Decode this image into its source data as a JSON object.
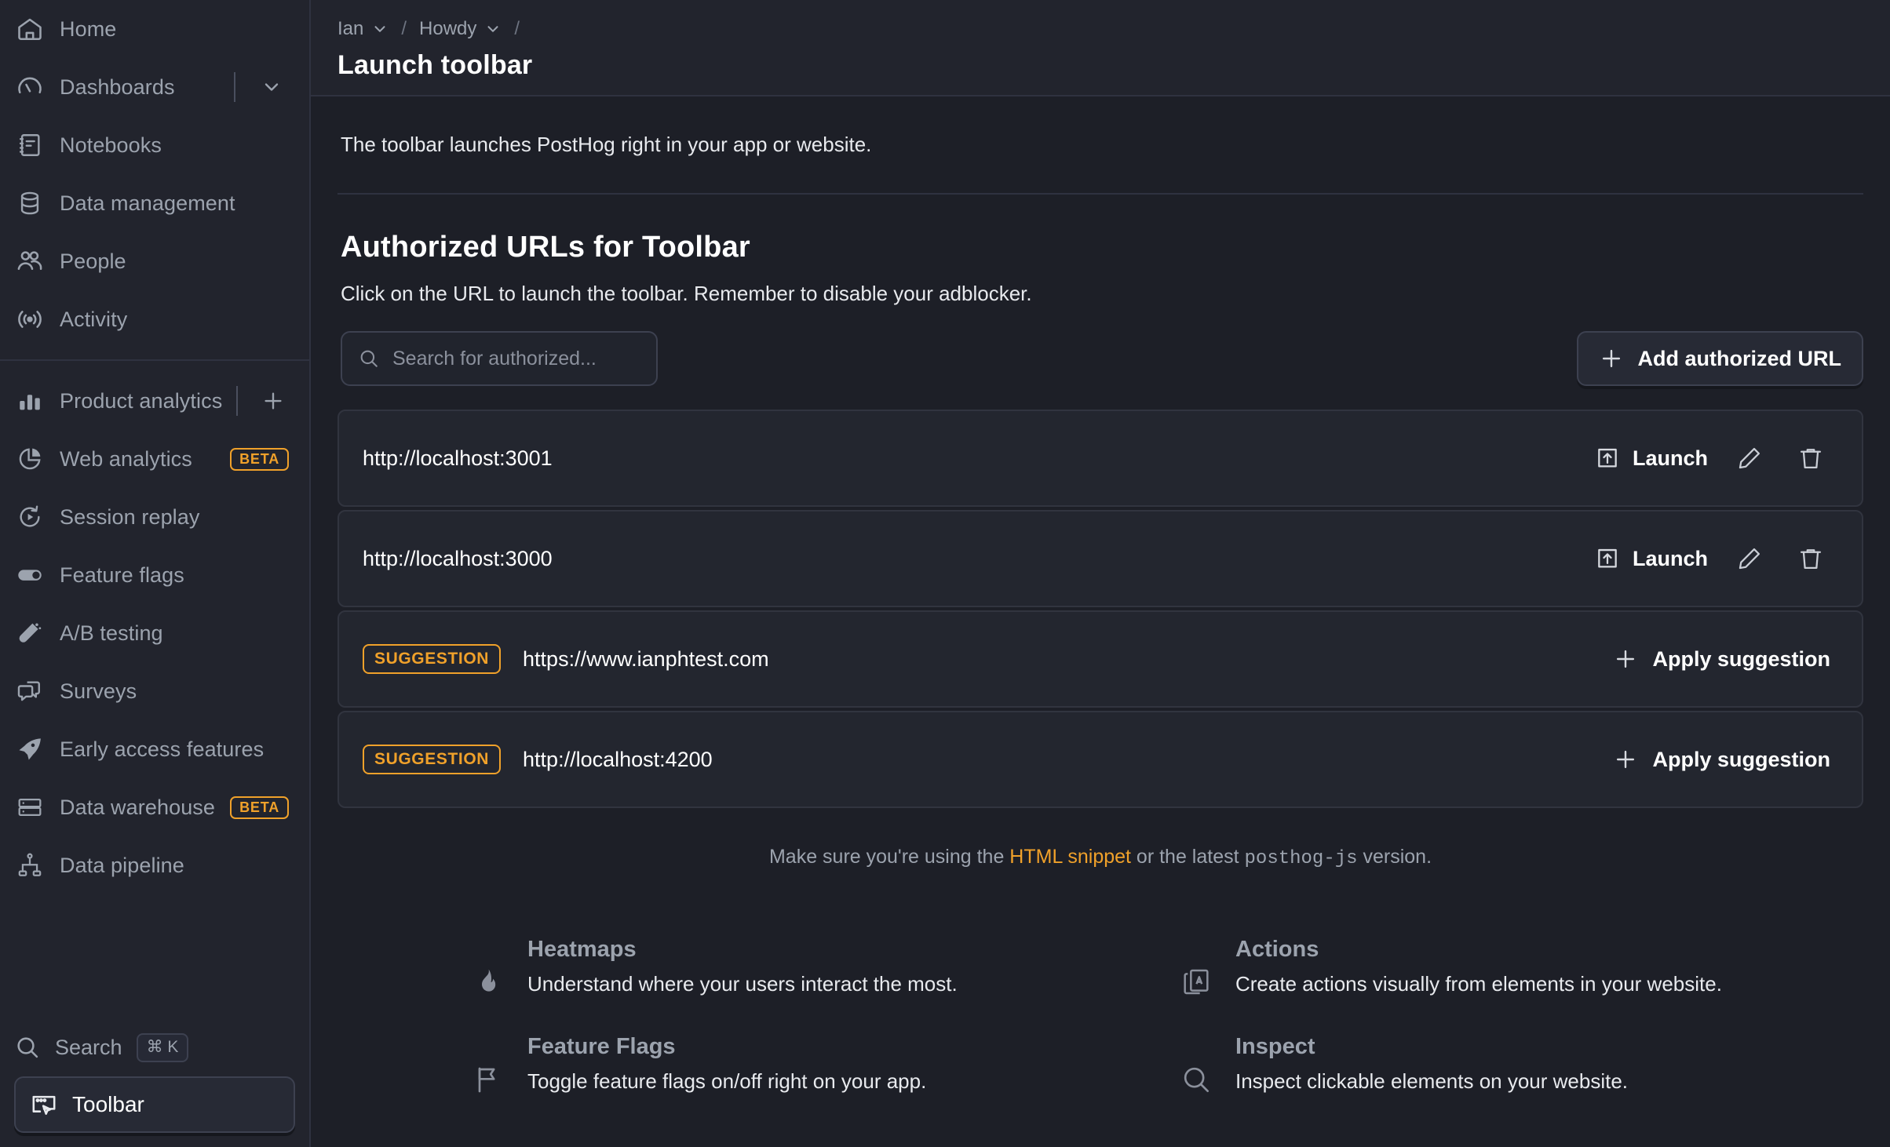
{
  "sidebar": {
    "primary_items": [
      {
        "label": "Home",
        "icon": "home-icon",
        "badge": null,
        "trailing": null
      },
      {
        "label": "Dashboards",
        "icon": "gauge-icon",
        "badge": null,
        "trailing": "chevron-down-icon"
      },
      {
        "label": "Notebooks",
        "icon": "notebook-icon",
        "badge": null,
        "trailing": null
      },
      {
        "label": "Data management",
        "icon": "database-icon",
        "badge": null,
        "trailing": null
      },
      {
        "label": "People",
        "icon": "people-icon",
        "badge": null,
        "trailing": null
      },
      {
        "label": "Activity",
        "icon": "broadcast-icon",
        "badge": null,
        "trailing": null
      }
    ],
    "product_items": [
      {
        "label": "Product analytics",
        "icon": "bar-chart-icon",
        "badge": null,
        "trailing": "plus-icon"
      },
      {
        "label": "Web analytics",
        "icon": "pie-chart-icon",
        "badge": "BETA",
        "trailing": null
      },
      {
        "label": "Session replay",
        "icon": "replay-icon",
        "badge": null,
        "trailing": null
      },
      {
        "label": "Feature flags",
        "icon": "toggle-icon",
        "badge": null,
        "trailing": null
      },
      {
        "label": "A/B testing",
        "icon": "flask-icon",
        "badge": null,
        "trailing": null
      },
      {
        "label": "Surveys",
        "icon": "chat-icon",
        "badge": null,
        "trailing": null
      },
      {
        "label": "Early access features",
        "icon": "rocket-icon",
        "badge": null,
        "trailing": null
      },
      {
        "label": "Data warehouse",
        "icon": "server-icon",
        "badge": "BETA",
        "trailing": null
      },
      {
        "label": "Data pipeline",
        "icon": "pipeline-icon",
        "badge": null,
        "trailing": null
      }
    ],
    "search": {
      "label": "Search",
      "shortcut": "⌘ K"
    },
    "toolbar": {
      "label": "Toolbar",
      "active": true
    }
  },
  "header": {
    "breadcrumbs": [
      {
        "label": "Ian",
        "has_chevron": true
      },
      {
        "label": "Howdy",
        "has_chevron": true
      }
    ],
    "separator": "/",
    "title": "Launch toolbar"
  },
  "main": {
    "intro": "The toolbar launches PostHog right in your app or website.",
    "section_title": "Authorized URLs for Toolbar",
    "section_subtitle": "Click on the URL to launch the toolbar. Remember to disable your adblocker.",
    "search": {
      "placeholder": "Search for authorized...",
      "value": ""
    },
    "add_button": {
      "label": "Add authorized URL",
      "icon": "plus-icon"
    },
    "rows": [
      {
        "type": "authorized",
        "url": "http://localhost:3001",
        "launch_label": "Launch",
        "launch_icon": "launch-icon",
        "edit_icon": "pencil-icon",
        "delete_icon": "trash-icon"
      },
      {
        "type": "authorized",
        "url": "http://localhost:3000",
        "launch_label": "Launch",
        "launch_icon": "launch-icon",
        "edit_icon": "pencil-icon",
        "delete_icon": "trash-icon"
      },
      {
        "type": "suggestion",
        "badge": "SUGGESTION",
        "url": "https://www.ianphtest.com",
        "apply_label": "Apply suggestion",
        "apply_icon": "plus-icon"
      },
      {
        "type": "suggestion",
        "badge": "SUGGESTION",
        "url": "http://localhost:4200",
        "apply_label": "Apply suggestion",
        "apply_icon": "plus-icon"
      }
    ],
    "footnote": {
      "prefix": "Make sure you're using the ",
      "link": "HTML snippet",
      "middle": " or the latest ",
      "code": "posthog-js",
      "suffix": " version."
    },
    "features": [
      {
        "name": "Heatmaps",
        "desc": "Understand where your users interact the most.",
        "icon": "flame-icon"
      },
      {
        "name": "Actions",
        "desc": "Create actions visually from elements in your website.",
        "icon": "actions-icon"
      },
      {
        "name": "Feature Flags",
        "desc": "Toggle feature flags on/off right on your app.",
        "icon": "flag-icon"
      },
      {
        "name": "Inspect",
        "desc": "Inspect clickable elements on your website.",
        "icon": "magnifier-icon"
      }
    ]
  },
  "colors": {
    "accent": "#f0a12a",
    "sidebar_bg": "#22242d",
    "main_bg": "#1d1f27",
    "row_bg": "#23262f",
    "border": "#2f3240",
    "text_primary": "#ffffff",
    "text_muted": "#9ca3ae"
  }
}
